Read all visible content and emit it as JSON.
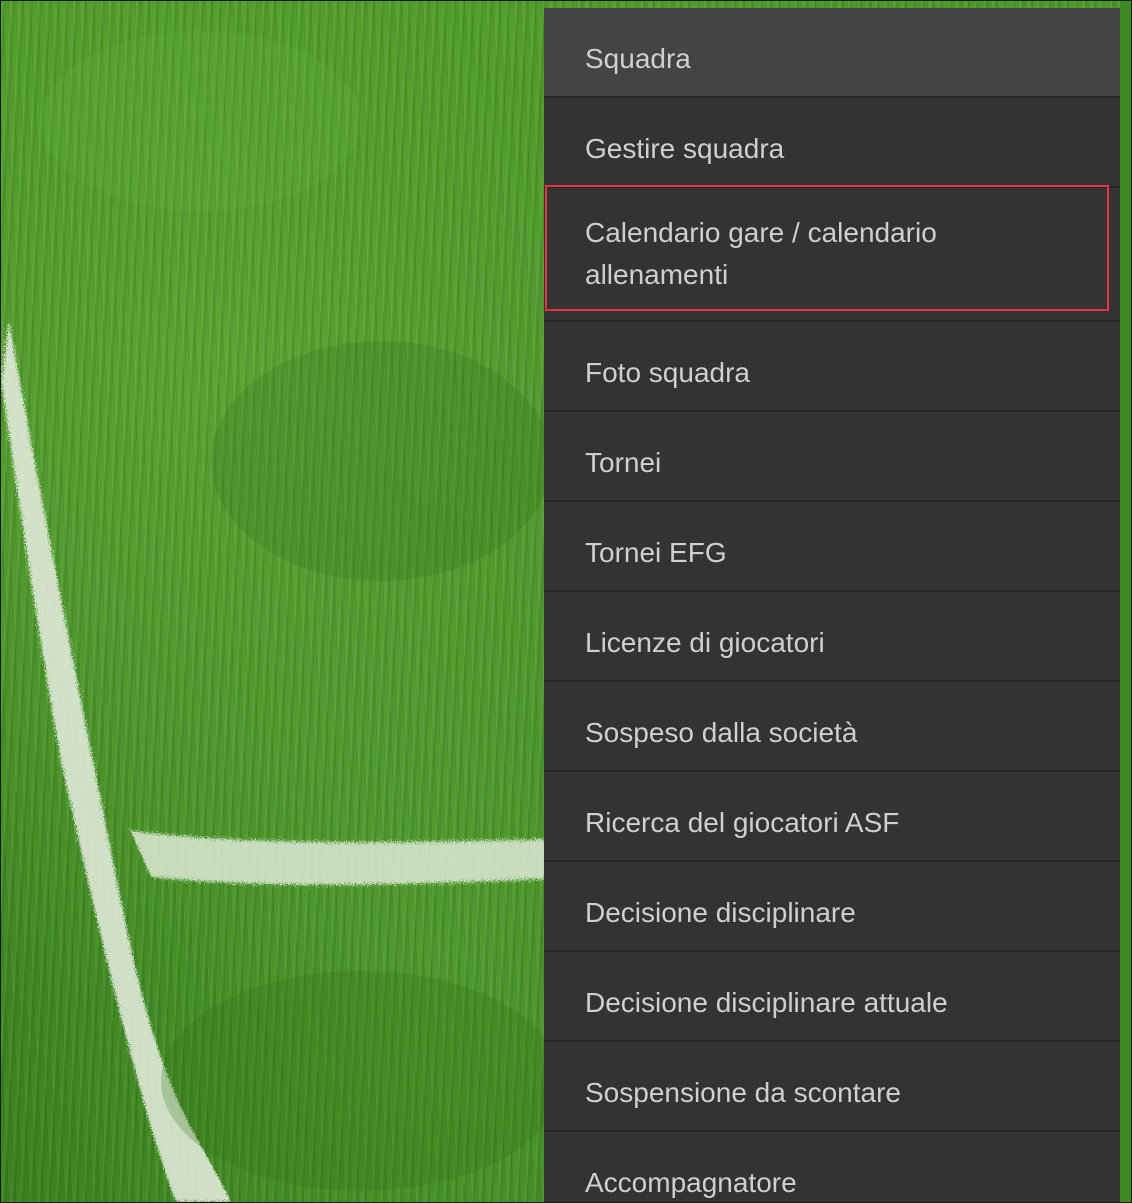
{
  "menu": {
    "items": [
      {
        "label": "Squadra"
      },
      {
        "label": "Gestire squadra"
      },
      {
        "label": "Calendario gare / calendario allenamenti"
      },
      {
        "label": "Foto squadra"
      },
      {
        "label": "Tornei"
      },
      {
        "label": "Tornei EFG"
      },
      {
        "label": "Licenze di giocatori"
      },
      {
        "label": "Sospeso dalla società"
      },
      {
        "label": "Ricerca del giocatori ASF"
      },
      {
        "label": "Decisione disciplinare"
      },
      {
        "label": "Decisione disciplinare attuale"
      },
      {
        "label": "Sospensione da scontare"
      },
      {
        "label": "Accompagnatore"
      }
    ],
    "highlighted_index": 2,
    "highlight_color": "#e0383e",
    "background_color": "#333333"
  },
  "background": {
    "description_icon": "grass-field-image"
  }
}
